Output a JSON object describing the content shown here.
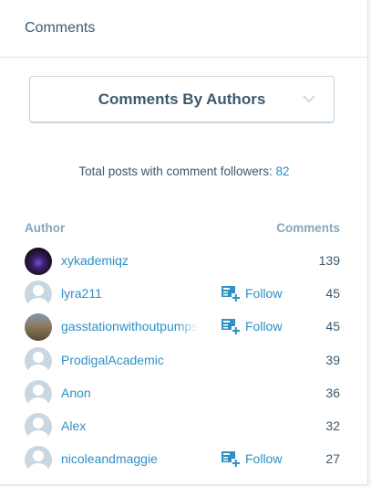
{
  "header": {
    "title": "Comments"
  },
  "selector": {
    "label": "Comments By Authors"
  },
  "summary": {
    "text": "Total posts with comment followers:",
    "count": "82"
  },
  "table": {
    "col_author": "Author",
    "col_comments": "Comments",
    "rows": [
      {
        "name": "xykademiqz",
        "comments": "139",
        "follow": ""
      },
      {
        "name": "lyra211",
        "comments": "45",
        "follow": "Follow"
      },
      {
        "name": "gasstationwithoutpumps",
        "comments": "45",
        "follow": "Follow"
      },
      {
        "name": "ProdigalAcademic",
        "comments": "39",
        "follow": ""
      },
      {
        "name": "Anon",
        "comments": "36",
        "follow": ""
      },
      {
        "name": "Alex",
        "comments": "32",
        "follow": ""
      },
      {
        "name": "nicoleandmaggie",
        "comments": "27",
        "follow": "Follow"
      }
    ]
  },
  "colors": {
    "link": "#2e90c5",
    "text": "#3d596d",
    "muted": "#87a6bc",
    "border": "#c8d7e1"
  },
  "icons": {
    "follow": "reader-follow-icon",
    "chevron": "chevron-down-icon",
    "avatar": "default-avatar-icon"
  }
}
